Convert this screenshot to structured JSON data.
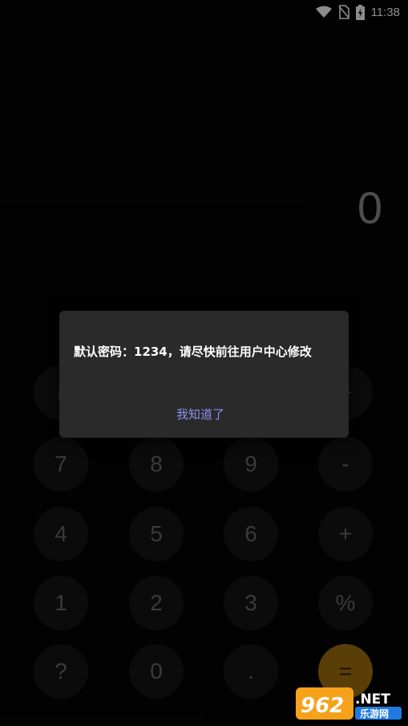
{
  "status_bar": {
    "time": "11:38",
    "icons": [
      "wifi-icon",
      "no-sim-icon",
      "battery-charging-icon"
    ]
  },
  "display": {
    "value": "0"
  },
  "keypad": {
    "row_hidden": [
      "(",
      "",
      "",
      "−"
    ],
    "row1": [
      "7",
      "8",
      "9",
      "-"
    ],
    "row2": [
      "4",
      "5",
      "6",
      "+"
    ],
    "row3": [
      "1",
      "2",
      "3",
      "%"
    ],
    "row4": [
      "?",
      "0",
      ".",
      "="
    ]
  },
  "dialog": {
    "message": "默认密码：1234，请尽快前往用户中心修改",
    "button_label": "我知道了"
  },
  "watermark": {
    "brand": "962.NET",
    "sub": "乐游网"
  },
  "colors": {
    "background": "#050505",
    "key": "#141414",
    "key_text": "#6a6a6a",
    "equals": "#a2720e",
    "dialog": "#2a2a2a",
    "dialog_button": "#8f8ff0"
  }
}
